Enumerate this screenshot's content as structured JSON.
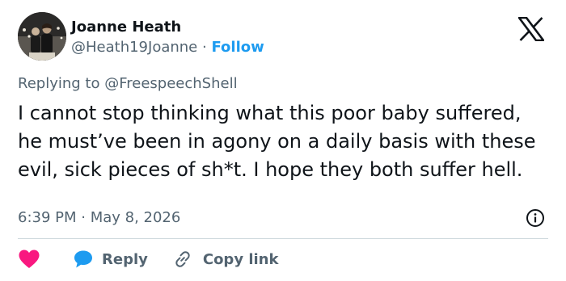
{
  "author": {
    "display_name": "Joanne Heath",
    "handle": "@Heath19Joanne",
    "separator": "·",
    "follow_label": "Follow"
  },
  "platform_icon": "x-logo",
  "reply_context": {
    "prefix": "Replying to",
    "mention": "@FreespeechShell"
  },
  "tweet": {
    "text": "I cannot stop thinking what this poor baby suffered, he must’ve been in agony on a daily basis with these evil, sick pieces of sh*t. I hope they both suffer hell.",
    "timestamp": "6:39 PM · May 8, 2026"
  },
  "actions": {
    "like_icon": "heart-icon",
    "like_color": "#f91880",
    "reply_label": "Reply",
    "reply_icon_color": "#1d9bf0",
    "copy_link_label": "Copy link"
  },
  "colors": {
    "text": "#0f1419",
    "secondary": "#536471",
    "accent": "#1d9bf0",
    "divider": "#cfd9de"
  }
}
